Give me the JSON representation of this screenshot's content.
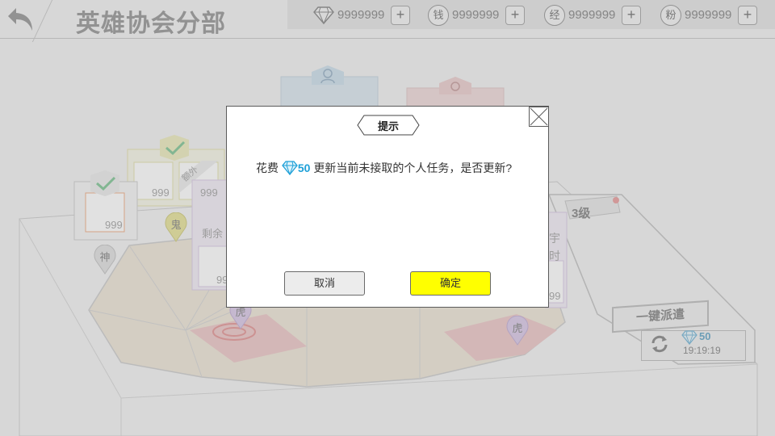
{
  "header": {
    "title": "英雄协会分部",
    "resources": [
      {
        "icon": "diamond-icon",
        "glyph": "",
        "value": "9999999"
      },
      {
        "icon": "coin-icon",
        "glyph": "钱",
        "value": "9999999"
      },
      {
        "icon": "exp-icon",
        "glyph": "经",
        "value": "9999999"
      },
      {
        "icon": "fan-icon",
        "glyph": "粉",
        "value": "9999999"
      }
    ],
    "plus_label": "+"
  },
  "board": {
    "cards": [
      {
        "id": "card-left",
        "value": "999",
        "checked": true
      },
      {
        "id": "card-mid",
        "value": "999",
        "checked": true
      },
      {
        "id": "card-purple",
        "value": "999"
      }
    ],
    "extra_tag": "额外",
    "remaining_label": "剩余",
    "purple_card_partial_value": "99",
    "right_card_partial_text_1": "宇",
    "right_card_partial_text_2": "时",
    "right_card_partial_value": "99",
    "pins": [
      {
        "id": "pin-shen",
        "label": "神",
        "color": "#dedede"
      },
      {
        "id": "pin-gui",
        "label": "鬼",
        "color": "#e6e39a"
      },
      {
        "id": "pin-hu-1",
        "label": "虎",
        "color": "#d6c4e4"
      },
      {
        "id": "pin-hu-2",
        "label": "虎",
        "color": "#d6c4e4"
      }
    ],
    "level_label": "3级",
    "dispatch_label": "一键派遣",
    "refresh_cost": "50",
    "refresh_timer": "19:19:19"
  },
  "dialog": {
    "title": "提示",
    "message_prefix": "花费",
    "cost": "50",
    "message_suffix": "更新当前未接取的个人任务，是否更新?",
    "cancel_label": "取消",
    "confirm_label": "确定",
    "confirm_color": "#ffff00"
  }
}
